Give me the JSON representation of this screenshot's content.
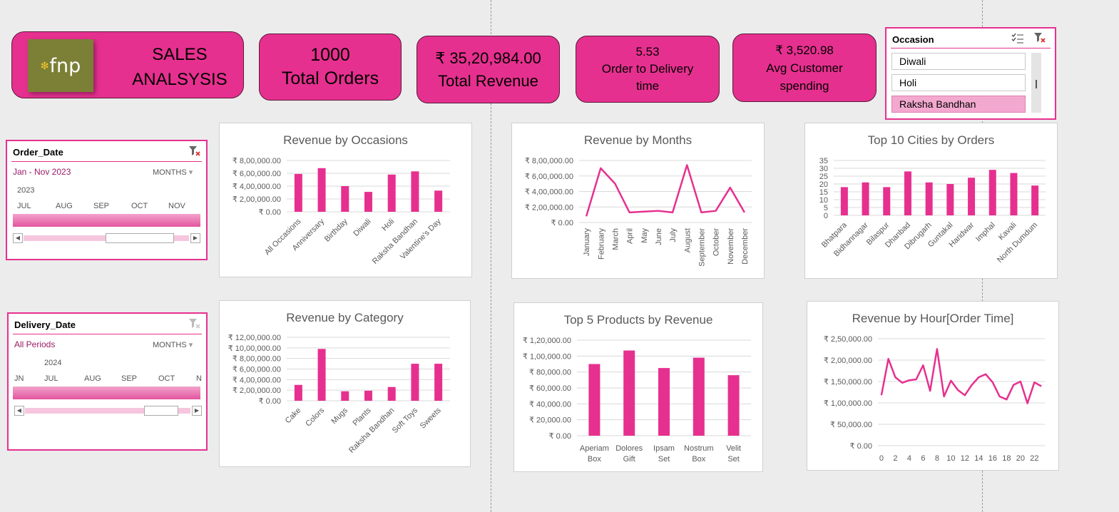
{
  "header": {
    "logo_text": "fnp",
    "title_line1": "SALES",
    "title_line2": "ANALSYSIS"
  },
  "kpis": [
    {
      "value": "1000",
      "label": "Total Orders"
    },
    {
      "value": "₹ 35,20,984.00",
      "label": "Total Revenue"
    },
    {
      "value": "5.53",
      "label": "Order to Delivery time"
    },
    {
      "value": "₹ 3,520.98",
      "label": "Avg Customer spending"
    }
  ],
  "occasion_slicer": {
    "title": "Occasion",
    "items": [
      "Diwali",
      "Holi",
      "Raksha Bandhan"
    ],
    "selected": "Raksha Bandhan"
  },
  "order_date_slicer": {
    "title": "Order_Date",
    "range": "Jan - Nov 2023",
    "level": "MONTHS",
    "year": "2023",
    "months": [
      "JUL",
      "AUG",
      "SEP",
      "OCT",
      "NOV"
    ]
  },
  "delivery_date_slicer": {
    "title": "Delivery_Date",
    "range": "All Periods",
    "level": "MONTHS",
    "year": "2024",
    "months": [
      "JN",
      "JUL",
      "AUG",
      "SEP",
      "OCT",
      "N"
    ]
  },
  "colors": {
    "accent": "#e6308f",
    "background": "#ececec",
    "gridline": "#d9d9d9"
  },
  "chart_data": [
    {
      "type": "bar",
      "title": "Revenue by Occasions",
      "categories": [
        "All Occasions",
        "Anniversary",
        "Birthday",
        "Diwali",
        "Holi",
        "Raksha Bandhan",
        "Valentine's Day"
      ],
      "values": [
        590000,
        680000,
        400000,
        310000,
        580000,
        630000,
        330000
      ],
      "ylim": [
        0,
        800000
      ],
      "yticks": [
        "₹ 0.00",
        "₹ 2,00,000.00",
        "₹ 4,00,000.00",
        "₹ 6,00,000.00",
        "₹ 8,00,000.00"
      ],
      "grid": true
    },
    {
      "type": "line",
      "title": "Revenue by Months",
      "categories": [
        "January",
        "February",
        "March",
        "April",
        "May",
        "June",
        "July",
        "August",
        "September",
        "October",
        "November",
        "December"
      ],
      "values": [
        80000,
        700000,
        500000,
        130000,
        140000,
        150000,
        130000,
        740000,
        130000,
        150000,
        450000,
        130000
      ],
      "ylim": [
        0,
        800000
      ],
      "yticks": [
        "₹ 0.00",
        "₹ 2,00,000.00",
        "₹ 4,00,000.00",
        "₹ 6,00,000.00",
        "₹ 8,00,000.00"
      ],
      "grid": true
    },
    {
      "type": "bar",
      "title": "Top 10 Cities by Orders",
      "categories": [
        "Bhatpara",
        "Bidhannagar",
        "Bilaspur",
        "Dhanbad",
        "Dibrugarh",
        "Guntakal",
        "Haridwar",
        "Imphal",
        "Kavali",
        "North Dumdum"
      ],
      "values": [
        18,
        21,
        18,
        28,
        21,
        20,
        24,
        29,
        27,
        19
      ],
      "ylim": [
        0,
        35
      ],
      "yticks": [
        "0",
        "5",
        "10",
        "15",
        "20",
        "25",
        "30",
        "35"
      ],
      "grid": true
    },
    {
      "type": "bar",
      "title": "Revenue by Category",
      "categories": [
        "Cake",
        "Colors",
        "Mugs",
        "Plants",
        "Raksha Bandhan",
        "Soft Toys",
        "Sweets"
      ],
      "values": [
        300000,
        980000,
        180000,
        190000,
        260000,
        700000,
        700000
      ],
      "ylim": [
        0,
        1200000
      ],
      "yticks": [
        "₹ 0.00",
        "₹ 2,00,000.00",
        "₹ 4,00,000.00",
        "₹ 6,00,000.00",
        "₹ 8,00,000.00",
        "₹ 10,00,000.00",
        "₹ 12,00,000.00"
      ],
      "grid": true
    },
    {
      "type": "bar",
      "title": "Top 5 Products by Revenue",
      "categories": [
        "Aperiam Box",
        "Dolores Gift",
        "Ipsam Set",
        "Nostrum Box",
        "Velit Set"
      ],
      "values": [
        90000,
        107000,
        85000,
        98000,
        76000
      ],
      "ylim": [
        0,
        120000
      ],
      "yticks": [
        "₹ 0.00",
        "₹ 20,000.00",
        "₹ 40,000.00",
        "₹ 60,000.00",
        "₹ 80,000.00",
        "₹ 1,00,000.00",
        "₹ 1,20,000.00"
      ],
      "grid": true
    },
    {
      "type": "line",
      "title": "Revenue by Hour[Order Time]",
      "x": [
        0,
        1,
        2,
        3,
        4,
        5,
        6,
        7,
        8,
        9,
        10,
        11,
        12,
        13,
        14,
        15,
        16,
        17,
        18,
        19,
        20,
        21,
        22,
        23
      ],
      "values": [
        118000,
        203000,
        160000,
        147000,
        153000,
        155000,
        188000,
        128000,
        226000,
        115000,
        152000,
        130000,
        118000,
        142000,
        160000,
        167000,
        148000,
        115000,
        108000,
        142000,
        150000,
        99000,
        148000,
        139000
      ],
      "xticks": [
        "0",
        "2",
        "4",
        "6",
        "8",
        "10",
        "12",
        "14",
        "16",
        "18",
        "20",
        "22"
      ],
      "ylim": [
        0,
        250000
      ],
      "yticks": [
        "₹ 0.00",
        "₹ 50,000.00",
        "₹ 1,00,000.00",
        "₹ 1,50,000.00",
        "₹ 2,00,000.00",
        "₹ 2,50,000.00"
      ],
      "grid": true
    }
  ]
}
